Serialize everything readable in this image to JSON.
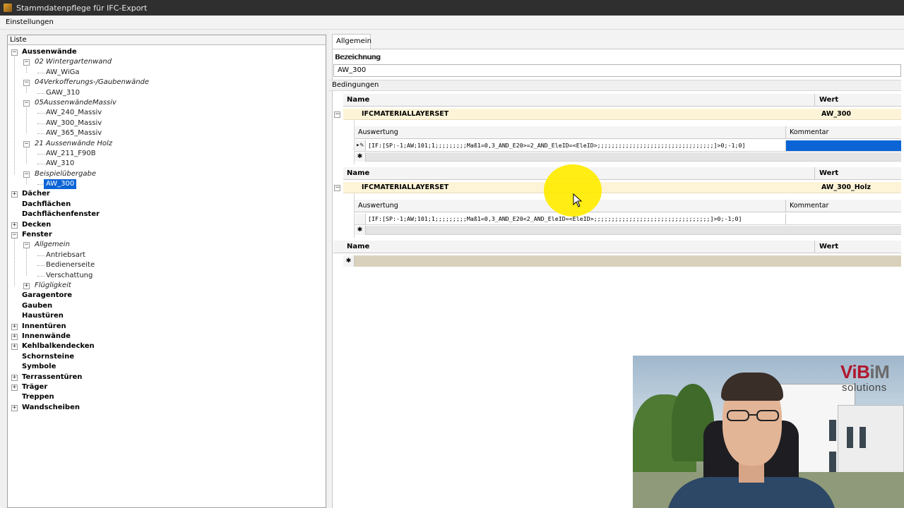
{
  "window": {
    "title": "Stammdatenpflege für IFC-Export"
  },
  "menu": {
    "items": [
      "Einstellungen"
    ]
  },
  "list": {
    "header": "Liste",
    "items": [
      {
        "label": "Aussenwände",
        "level": 0,
        "expander": "−"
      },
      {
        "label": "02 Wintergartenwand",
        "level": 1,
        "expander": "−"
      },
      {
        "label": "AW_WiGa",
        "level": 2,
        "expander": ""
      },
      {
        "label": "04Verkofferungs-/Gaubenwände",
        "level": 1,
        "expander": "−"
      },
      {
        "label": "GAW_310",
        "level": 2,
        "expander": ""
      },
      {
        "label": "05AussenwändeMassiv",
        "level": 1,
        "expander": "−"
      },
      {
        "label": "AW_240_Massiv",
        "level": 2,
        "expander": ""
      },
      {
        "label": "AW_300_Massiv",
        "level": 2,
        "expander": ""
      },
      {
        "label": "AW_365_Massiv",
        "level": 2,
        "expander": ""
      },
      {
        "label": "21 Aussenwände Holz",
        "level": 1,
        "expander": "−"
      },
      {
        "label": "AW_211_F90B",
        "level": 2,
        "expander": ""
      },
      {
        "label": "AW_310",
        "level": 2,
        "expander": ""
      },
      {
        "label": "Beispielübergabe",
        "level": 1,
        "expander": "−"
      },
      {
        "label": "AW_300",
        "level": 2,
        "expander": "",
        "selected": true
      },
      {
        "label": "Dächer",
        "level": 0,
        "expander": "+"
      },
      {
        "label": "Dachflächen",
        "level": 0,
        "expander": ""
      },
      {
        "label": "Dachflächenfenster",
        "level": 0,
        "expander": ""
      },
      {
        "label": "Decken",
        "level": 0,
        "expander": "+"
      },
      {
        "label": "Fenster",
        "level": 0,
        "expander": "−"
      },
      {
        "label": "Allgemein",
        "level": 1,
        "expander": "−"
      },
      {
        "label": "Antriebsart",
        "level": 2,
        "expander": ""
      },
      {
        "label": "Bedienerseite",
        "level": 2,
        "expander": ""
      },
      {
        "label": "Verschattung",
        "level": 2,
        "expander": ""
      },
      {
        "label": "Flügligkeit",
        "level": 1,
        "expander": "+"
      },
      {
        "label": "Garagentore",
        "level": 0,
        "expander": ""
      },
      {
        "label": "Gauben",
        "level": 0,
        "expander": ""
      },
      {
        "label": "Haustüren",
        "level": 0,
        "expander": ""
      },
      {
        "label": "Innentüren",
        "level": 0,
        "expander": "+"
      },
      {
        "label": "Innenwände",
        "level": 0,
        "expander": "+"
      },
      {
        "label": "Kehlbalkendecken",
        "level": 0,
        "expander": "+"
      },
      {
        "label": "Schornsteine",
        "level": 0,
        "expander": ""
      },
      {
        "label": "Symbole",
        "level": 0,
        "expander": ""
      },
      {
        "label": "Terrassentüren",
        "level": 0,
        "expander": "+"
      },
      {
        "label": "Träger",
        "level": 0,
        "expander": "+"
      },
      {
        "label": "Treppen",
        "level": 0,
        "expander": ""
      },
      {
        "label": "Wandscheiben",
        "level": 0,
        "expander": "+"
      }
    ]
  },
  "detail": {
    "tab": "Allgemein",
    "bezeichnung_label": "Bezeichnung",
    "bezeichnung_value": "AW_300",
    "bedingungen_label": "Bedingungen",
    "col_name": "Name",
    "col_wert": "Wert",
    "col_auswertung": "Auswertung",
    "col_kommentar": "Kommentar",
    "conditions": [
      {
        "name": "IFCMATERIALLAYERSET",
        "wert": "AW_300",
        "auswertung": "[IF:[SP:-1;AW;101;1;;;;;;;;;Maß1=0,3_AND_E20>=2_AND_EleID=<EleID>;;;;;;;;;;;;;;;;;;;;;;;;;;;;;;;;;]>0;-1;0]",
        "kommentar": ""
      },
      {
        "name": "IFCMATERIALLAYERSET",
        "wert": "AW_300_Holz",
        "auswertung": "[IF:[SP:-1;AW;101;1;;;;;;;;;Maß1=0,3_AND_E20<2_AND_EleID=<EleID>;;;;;;;;;;;;;;;;;;;;;;;;;;;;;;;;;]>0;-1;0]",
        "kommentar": ""
      }
    ],
    "new_row_symbol": "✱",
    "edit_row_symbol": "▸✎"
  },
  "overlay": {
    "logo_vi": "ViB",
    "logo_im": "iM",
    "logo_sub": "solutions"
  }
}
